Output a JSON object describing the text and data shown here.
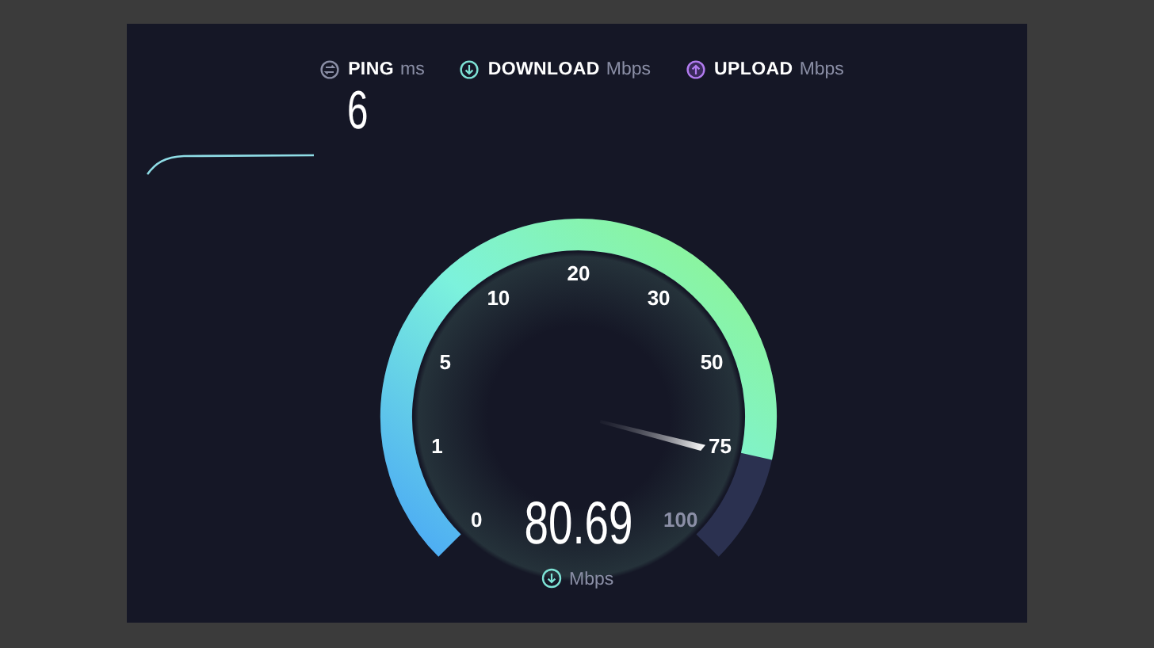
{
  "metrics": [
    {
      "kind": "ping",
      "label": "PING",
      "unit": "ms"
    },
    {
      "kind": "download",
      "label": "DOWNLOAD",
      "unit": "Mbps"
    },
    {
      "kind": "upload",
      "label": "UPLOAD",
      "unit": "Mbps"
    }
  ],
  "ping_value": "6",
  "gauge": {
    "ticks": [
      "0",
      "1",
      "5",
      "10",
      "20",
      "30",
      "50",
      "75",
      "100"
    ],
    "level": 0.88,
    "reading": "80.69",
    "unit": "Mbps"
  }
}
